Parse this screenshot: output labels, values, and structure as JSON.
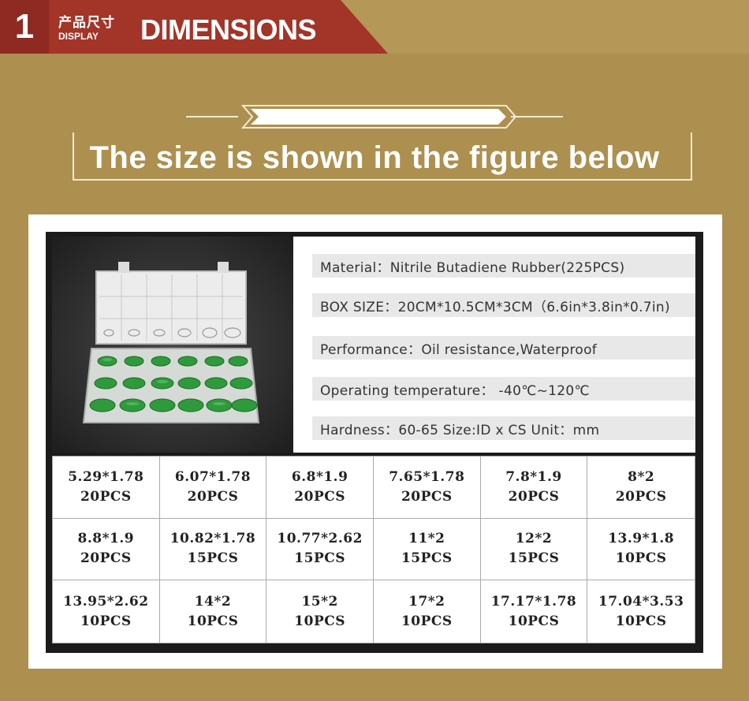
{
  "header": {
    "number": "1",
    "cn_label": "产品尺寸",
    "en_small": "DISPLAY",
    "title": "DIMENSIONS"
  },
  "banner": {
    "text": "The size is shown in the figure below"
  },
  "specs": [
    "Material：Nitrile Butadiene Rubber(225PCS)",
    "BOX SIZE：20CM*10.5CM*3CM（6.6in*3.8in*0.7in)",
    "Performance：Oil resistance,Waterproof",
    "Operating temperature： -40℃~120℃",
    "Hardness：60-65  Size:ID x CS    Unit：mm"
  ],
  "sizes": [
    {
      "size": "5.29*1.78",
      "qty": "20PCS"
    },
    {
      "size": "6.07*1.78",
      "qty": "20PCS"
    },
    {
      "size": "6.8*1.9",
      "qty": "20PCS"
    },
    {
      "size": "7.65*1.78",
      "qty": "20PCS"
    },
    {
      "size": "7.8*1.9",
      "qty": "20PCS"
    },
    {
      "size": "8*2",
      "qty": "20PCS"
    },
    {
      "size": "8.8*1.9",
      "qty": "20PCS"
    },
    {
      "size": "10.82*1.78",
      "qty": "15PCS"
    },
    {
      "size": "10.77*2.62",
      "qty": "15PCS"
    },
    {
      "size": "11*2",
      "qty": "15PCS"
    },
    {
      "size": "12*2",
      "qty": "15PCS"
    },
    {
      "size": "13.9*1.8",
      "qty": "10PCS"
    },
    {
      "size": "13.95*2.62",
      "qty": "10PCS"
    },
    {
      "size": "14*2",
      "qty": "10PCS"
    },
    {
      "size": "15*2",
      "qty": "10PCS"
    },
    {
      "size": "17*2",
      "qty": "10PCS"
    },
    {
      "size": "17.17*1.78",
      "qty": "10PCS"
    },
    {
      "size": "17.04*3.53",
      "qty": "10PCS"
    }
  ],
  "colors": {
    "background": "#ad8f4f",
    "header_red": "#a33428",
    "oring_green": "#2f9a3c"
  }
}
